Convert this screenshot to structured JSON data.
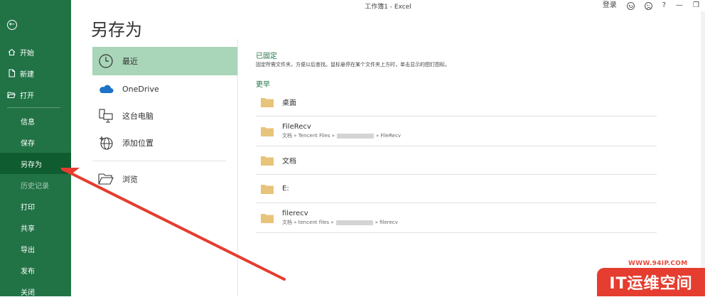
{
  "window": {
    "title": "工作簿1  -  Excel",
    "signin": "登录",
    "help": "?",
    "min": "—",
    "restore": "❐"
  },
  "sidebar": {
    "back_icon": "back-arrow-icon",
    "top_items": [
      {
        "label": "开始",
        "icon": "home-icon"
      },
      {
        "label": "新建",
        "icon": "new-file-icon"
      },
      {
        "label": "打开",
        "icon": "open-folder-icon"
      }
    ],
    "items": [
      {
        "label": "信息"
      },
      {
        "label": "保存"
      },
      {
        "label": "另存为",
        "active": true
      },
      {
        "label": "历史记录",
        "disabled": true
      },
      {
        "label": "打印"
      },
      {
        "label": "共享"
      },
      {
        "label": "导出"
      },
      {
        "label": "发布"
      },
      {
        "label": "关闭"
      }
    ]
  },
  "main": {
    "title": "另存为",
    "locations": [
      {
        "label": "最近",
        "icon": "clock-icon"
      },
      {
        "label": "OneDrive",
        "icon": "cloud-icon"
      },
      {
        "label": "这台电脑",
        "icon": "computer-icon"
      },
      {
        "label": "添加位置",
        "icon": "globe-plus-icon"
      },
      {
        "label": "浏览",
        "icon": "folder-open-icon"
      }
    ],
    "pinned_heading": "已固定",
    "pinned_description": "固定所需文件夹，方便以后查找。鼠标悬停在某个文件夹上方时，单击显示的图钉图标。",
    "older_heading": "更早",
    "folders": [
      {
        "name": "桌面"
      },
      {
        "name": "FileRecv",
        "path_start": "文档 » Tencent Files »",
        "path_end": "» FileRecv"
      },
      {
        "name": "文档"
      },
      {
        "name": "E:"
      },
      {
        "name": "filerecv",
        "path_start": "文档 » tencent files »",
        "path_end": "» filerecv"
      }
    ]
  },
  "watermark": {
    "url": "WWW.94IP.COM",
    "brand": "IT运维空间"
  },
  "colors": {
    "sidebar": "#217346",
    "sidebar_active": "#0e5c2f",
    "location_active": "#a9d5b8",
    "accent_text": "#217346",
    "folder": "#e8c37a",
    "arrow": "#e53d2f"
  }
}
